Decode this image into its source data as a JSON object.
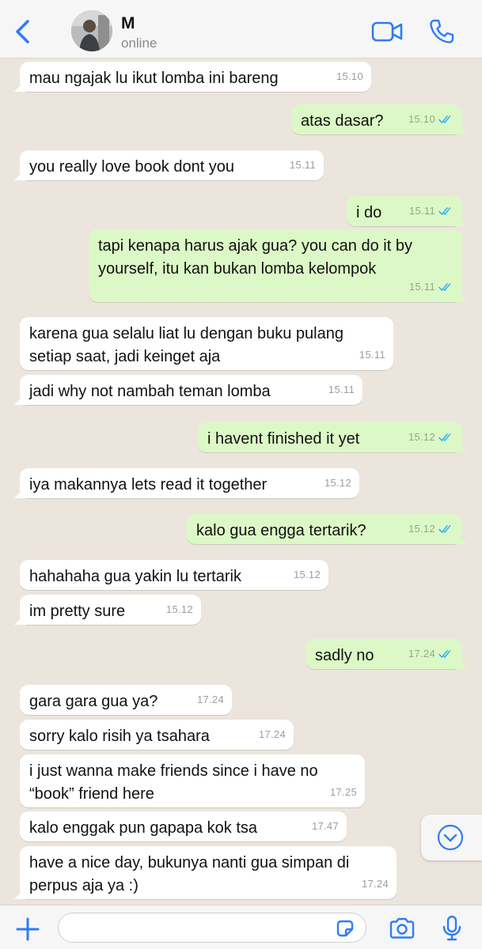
{
  "contact": {
    "name": "M",
    "status": "online"
  },
  "composer": {
    "placeholder": ""
  },
  "messages": [
    {
      "dir": "in",
      "lines": [
        "mau ngajak lu ikut lomba ini bareng"
      ],
      "time": "15.10"
    },
    {
      "dir": "out",
      "lines": [
        "atas dasar?"
      ],
      "time": "15.10",
      "read": true
    },
    {
      "dir": "in",
      "lines": [
        "you really love book dont you"
      ],
      "time": "15.11"
    },
    {
      "dir": "out",
      "lines": [
        "i do"
      ],
      "time": "15.11",
      "read": true
    },
    {
      "dir": "out",
      "lines": [
        "tapi kenapa harus ajak gua? you can do it by",
        "yourself, itu kan bukan lomba kelompok"
      ],
      "time": "15.11",
      "read": true
    },
    {
      "dir": "in",
      "lines": [
        "karena gua selalu liat lu dengan buku pulang",
        "setiap saat, jadi keinget aja"
      ],
      "time": "15.11"
    },
    {
      "dir": "in",
      "lines": [
        "jadi why not nambah teman lomba"
      ],
      "time": "15.11"
    },
    {
      "dir": "out",
      "lines": [
        "i havent finished it yet"
      ],
      "time": "15.12",
      "read": true
    },
    {
      "dir": "in",
      "lines": [
        "iya makannya lets read it together"
      ],
      "time": "15.12"
    },
    {
      "dir": "out",
      "lines": [
        "kalo gua engga tertarik?"
      ],
      "time": "15.12",
      "read": true
    },
    {
      "dir": "in",
      "lines": [
        "hahahaha gua yakin lu tertarik"
      ],
      "time": "15.12"
    },
    {
      "dir": "in",
      "lines": [
        "im pretty sure"
      ],
      "time": "15.12"
    },
    {
      "dir": "out",
      "lines": [
        "sadly no"
      ],
      "time": "17.24",
      "read": true
    },
    {
      "dir": "in",
      "lines": [
        "gara gara gua ya?"
      ],
      "time": "17.24"
    },
    {
      "dir": "in",
      "lines": [
        "sorry kalo risih ya tsahara"
      ],
      "time": "17.24"
    },
    {
      "dir": "in",
      "lines": [
        "i just wanna make friends since i have no",
        "“book” friend here"
      ],
      "time": "17.25"
    },
    {
      "dir": "in",
      "lines": [
        "kalo enggak pun gapapa kok tsa"
      ],
      "time": "17.47"
    },
    {
      "dir": "in",
      "lines": [
        "have a nice day, bukunya nanti gua simpan di",
        "perpus aja ya :)"
      ],
      "time": "17.24"
    }
  ],
  "icons": {
    "back": "chevron-left-icon",
    "video": "video-camera-icon",
    "call": "phone-icon",
    "scroll": "chevron-down-circle-icon",
    "plus": "plus-icon",
    "sticker": "sticker-icon",
    "camera": "camera-icon",
    "mic": "microphone-icon",
    "read": "double-check-icon"
  },
  "colors": {
    "accent": "#2F7CF6",
    "wallpaper": "#ECE5DD",
    "outgoing": "#DCF8C6",
    "incoming": "#FFFFFF",
    "read_tick": "#34B7F1"
  }
}
